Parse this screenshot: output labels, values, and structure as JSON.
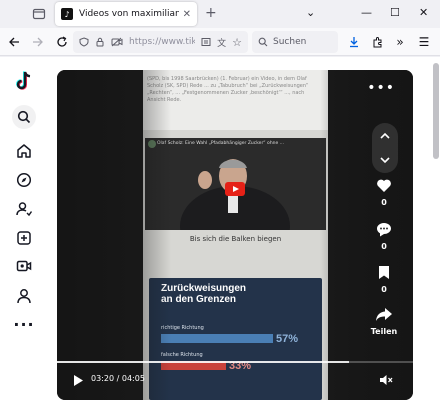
{
  "browser": {
    "tab_title": "Videos von maximilianbaehring",
    "tab_favicon": "tiktok-icon",
    "url": "https://www.tiktok.com/@maximilianbaehring",
    "search_placeholder": "Suchen"
  },
  "sidebar": {
    "items": [
      "tiktok-logo",
      "search-icon",
      "home-icon",
      "explore-icon",
      "following-icon",
      "upload-icon",
      "live-icon",
      "profile-icon",
      "more-icon"
    ]
  },
  "video": {
    "article_snippet": "(SPD, bis 1998 Saarbrücken) (1. Februar) ein Video, in dem Olaf Scholz (SK, SPD) Rede ... zu „Tabubruch“ bei „Zurückweisungen“ „Rechten“, ... „Festgenommenen Zucker ‚beschönigt‘“ ..., nach Ansicht Rede.",
    "embed_title": "Olaf Scholz: Eine Wahl „Pfadabhängiger Zucker“ ohne ...",
    "caption": "Bis sich die Balken biegen",
    "infobox": {
      "title_line1": "Zurückweisungen",
      "title_line2": "an den Grenzen",
      "rows": [
        {
          "label": "richtige Richtung",
          "value": "57%",
          "fraction": 0.57
        },
        {
          "label": "falsche Richtung",
          "value": "33%",
          "fraction": 0.33
        }
      ]
    },
    "actions": {
      "likes": "0",
      "comments": "0",
      "saves": "0",
      "share_label": "Teilen"
    },
    "current_time": "03:20",
    "duration": "04:05",
    "progress": 0.82
  },
  "colors": {
    "bar_blue": "#4a7fb5",
    "bar_red": "#c9423b",
    "infobox_bg": "#23334a"
  }
}
